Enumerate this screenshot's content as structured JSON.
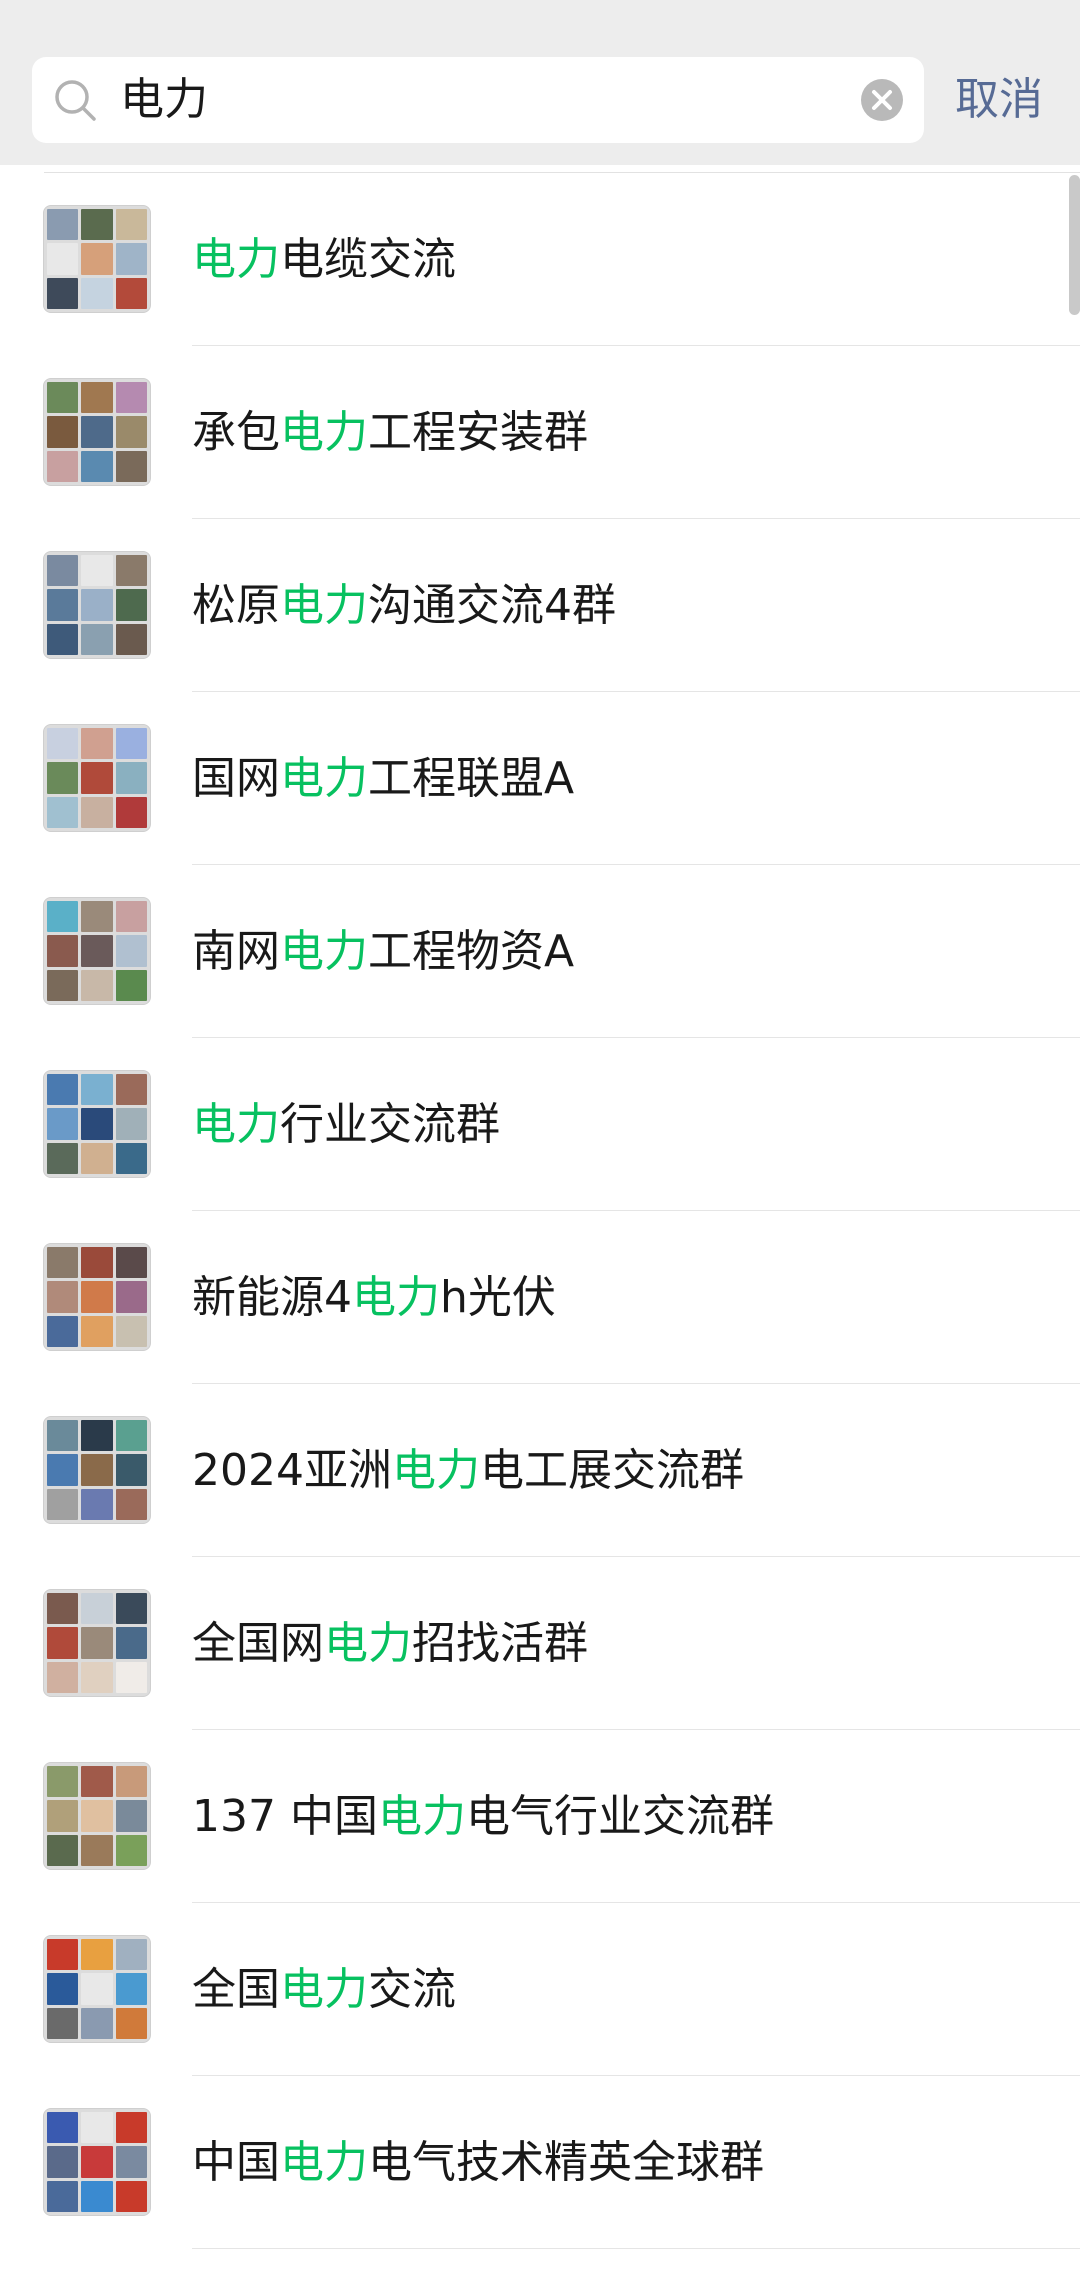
{
  "search": {
    "query": "电力",
    "cancel_label": "取消"
  },
  "colors": {
    "highlight": "#07c160",
    "cancel": "#576b95",
    "header_bg": "#ededed"
  },
  "icons": [
    "search-icon",
    "clear-icon"
  ],
  "results": [
    {
      "pre": "",
      "hl": "电力",
      "post": "电缆交流"
    },
    {
      "pre": "承包",
      "hl": "电力",
      "post": "工程安装群"
    },
    {
      "pre": "松原",
      "hl": "电力",
      "post": "沟通交流4群"
    },
    {
      "pre": "国网",
      "hl": "电力",
      "post": "工程联盟A"
    },
    {
      "pre": "南网",
      "hl": "电力",
      "post": "工程物资A"
    },
    {
      "pre": "",
      "hl": "电力",
      "post": "行业交流群"
    },
    {
      "pre": "新能源4",
      "hl": "电力",
      "post": "h光伏"
    },
    {
      "pre": "2024亚洲",
      "hl": "电力",
      "post": "电工展交流群"
    },
    {
      "pre": "全国网",
      "hl": "电力",
      "post": "招找活群"
    },
    {
      "pre": "137 中国",
      "hl": "电力",
      "post": "电气行业交流群"
    },
    {
      "pre": "全国",
      "hl": "电力",
      "post": "交流"
    },
    {
      "pre": "中国",
      "hl": "电力",
      "post": "电气技术精英全球群"
    }
  ]
}
